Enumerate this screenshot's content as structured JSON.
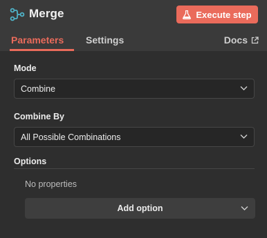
{
  "header": {
    "title": "Merge",
    "node_icon": "merge-icon",
    "execute_label": "Execute step",
    "execute_icon": "flask-icon"
  },
  "tabs": [
    {
      "label": "Parameters",
      "active": true
    },
    {
      "label": "Settings",
      "active": false
    }
  ],
  "docs": {
    "label": "Docs",
    "icon": "external-link-icon"
  },
  "fields": {
    "mode": {
      "label": "Mode",
      "value": "Combine"
    },
    "combine_by": {
      "label": "Combine By",
      "value": "All Possible Combinations"
    }
  },
  "options": {
    "label": "Options",
    "empty_text": "No properties",
    "add_label": "Add option"
  },
  "colors": {
    "accent": "#ea6b5b",
    "icon_teal": "#4fb3c8",
    "background": "#2e2e2e",
    "header": "#3a3a3a"
  }
}
